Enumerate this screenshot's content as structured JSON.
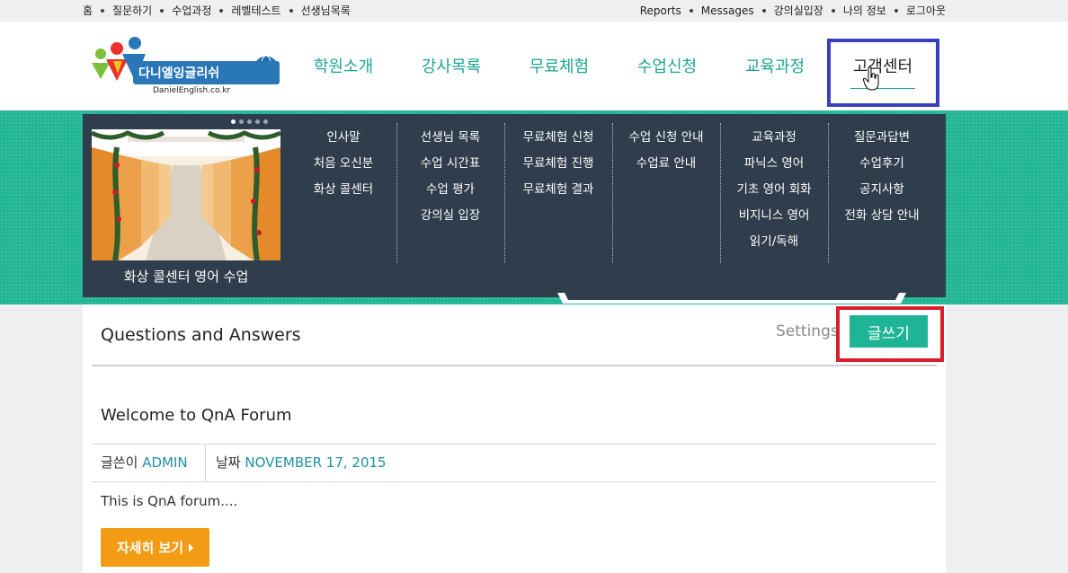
{
  "topbar": {
    "left_links": [
      "홈",
      "질문하기",
      "수업과정",
      "레벨테스트",
      "선생님목록"
    ],
    "right_links": [
      "Reports",
      "Messages",
      "강의실입장",
      "나의 정보",
      "로그아웃"
    ]
  },
  "logo": {
    "brand": "다니엘잉글리쉬",
    "domain": "DanielEnglish.co.kr"
  },
  "main_nav": [
    "학원소개",
    "강사목록",
    "무료체험",
    "수업신청",
    "교육과정",
    "고객센터"
  ],
  "main_nav_active": "고객센터",
  "mega_menu": {
    "caption": "화상 콜센터 영어 수업",
    "columns": [
      [
        "인사말",
        "처음 오신분",
        "화상 콜센터"
      ],
      [
        "선생님 목록",
        "수업 시간표",
        "수업 평가",
        "강의실 입장"
      ],
      [
        "무료체험 신청",
        "무료체험 진행",
        "무료체험 결과"
      ],
      [
        "수업 신청 안내",
        "수업료 안내"
      ],
      [
        "교육과정",
        "파닉스 영어",
        "기초 영어 회화",
        "비지니스 영어",
        "읽기/독해"
      ],
      [
        "질문과답변",
        "수업후기",
        "공지사항",
        "전화 상담 안내"
      ]
    ],
    "slides": 5,
    "active_slide": 1
  },
  "board": {
    "title": "Questions and Answers",
    "settings_label": "Settings",
    "write_label": "글쓰기"
  },
  "post": {
    "title": "Welcome to QnA Forum",
    "author_label": "글쓴이",
    "author": "ADMIN",
    "date_label": "날짜",
    "date": "NOVEMBER 17, 2015",
    "excerpt": "This is QnA forum....",
    "more_label": "자세히 보기"
  },
  "colors": {
    "teal": "#21b596",
    "nav_text": "#1aa591",
    "menu_bg": "#2f3d4c",
    "orange": "#f29b15",
    "highlight_blue": "#3a3fbf",
    "highlight_red": "#d91f2a"
  }
}
